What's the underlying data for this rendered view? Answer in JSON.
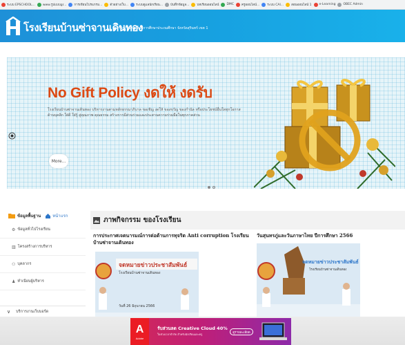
{
  "bookmarks": [
    {
      "label": "ระบบ EPSCHOOL...",
      "color": "#ea4335"
    },
    {
      "label": "www.รูปแบบgr...",
      "color": "#34a853"
    },
    {
      "label": "การเขียนโปรแกรม...",
      "color": "#4285f4"
    },
    {
      "label": "ตัวอย่างเว็บ...",
      "color": "#fbbc05"
    },
    {
      "label": "ระบบดูแลนักเรียน...",
      "color": "#4285f4"
    },
    {
      "label": "บันทึกข้อมูล...",
      "color": "#9aa0a6"
    },
    {
      "label": "บทเรียนออนไลน์",
      "color": "#fbbc05"
    },
    {
      "label": "DMC",
      "color": "#34a853"
    },
    {
      "label": "ครูออนไลน์...",
      "color": "#ea4335"
    },
    {
      "label": "ระบบ CAI...",
      "color": "#4285f4"
    },
    {
      "label": "สอนออนไลน์ 1",
      "color": "#fbbc05"
    },
    {
      "label": "e-Learning",
      "color": "#ea4335"
    },
    {
      "label": "OBEC Admin",
      "color": "#9aa0a6"
    }
  ],
  "header": {
    "school_name": "โรงเรียนบ้านซ่าจานเดินทอง",
    "address": "สำนักงานเขตพื้นที่การศึกษาประถมศึกษา จังหวัดสุรินทร์ เขต 1"
  },
  "banner": {
    "title": "No Gift Policy งดให้ งดรับ",
    "text": "โรงเรียนบ้านซ่าจานเดินทอง บริหารงานตามหลักธรรมาภิบาล ขอเชิญ งดให้ ของขวัญ ของกำนัล หรือประโยชน์อื่นใดทุกโอกาส ด้านบุคลิก ใฝ่ดี ใฝ่รู้ สู่คุณภาพ คุณธรรม สร้างการมีส่วนร่วมและประสานความร่วมมือในทุกภาคส่วน",
    "more_label": "More..."
  },
  "sidebar": {
    "heading": "ข้อมูลพื้นฐาน",
    "home_label": "หน้าแรก",
    "items": [
      {
        "label": "ข้อมูลทั่วไปโรงเรียน",
        "icon": "gear-icon"
      },
      {
        "label": "โครงสร้างการบริหาร",
        "icon": "chart-icon"
      },
      {
        "label": "บุคลากร",
        "icon": "people-icon"
      },
      {
        "label": "ทำเนียบผู้บริหาร",
        "icon": "person-icon"
      }
    ],
    "dropdown_label": "บริการงานเว็บบอร์ด"
  },
  "activities": {
    "title": "ภาพกิจกรรม ของโรงเรียน",
    "items": [
      {
        "headline": "การประกาศเจตนารมณ์การต่อต้านการทุจริต Anti corruption โรงเรียนบ้านซ่าจานเดินทอง",
        "banner_text": "จดหมายข่าวประชาสัมพันธ์",
        "banner_sub": "โรงเรียนบ้านซ่าจานเดินทอง",
        "date": "วันที่ 26 มิถุนายน 2566"
      },
      {
        "headline": "วันสุนทรภู่และวันภาษาไทย ปีการศึกษา 2566",
        "banner_text": "จดหมายข่าวประชาสัมพันธ์",
        "banner_sub": "โรงเรียนบ้านซ่าจานเดินทอง",
        "date": ""
      }
    ]
  },
  "ad": {
    "brand": "A",
    "brand_sub": "Adobe",
    "headline": "รับส่วนลด Creative Cloud 40%",
    "subtext": "ในช่วงเวลาจำกัด สำหรับนักเรียนและครู",
    "cta": "ดูรายละเอียด"
  },
  "colors": {
    "header_blue": "#1e90d8",
    "banner_title": "#dc4a14",
    "ad_magenta": "#c2206c"
  }
}
